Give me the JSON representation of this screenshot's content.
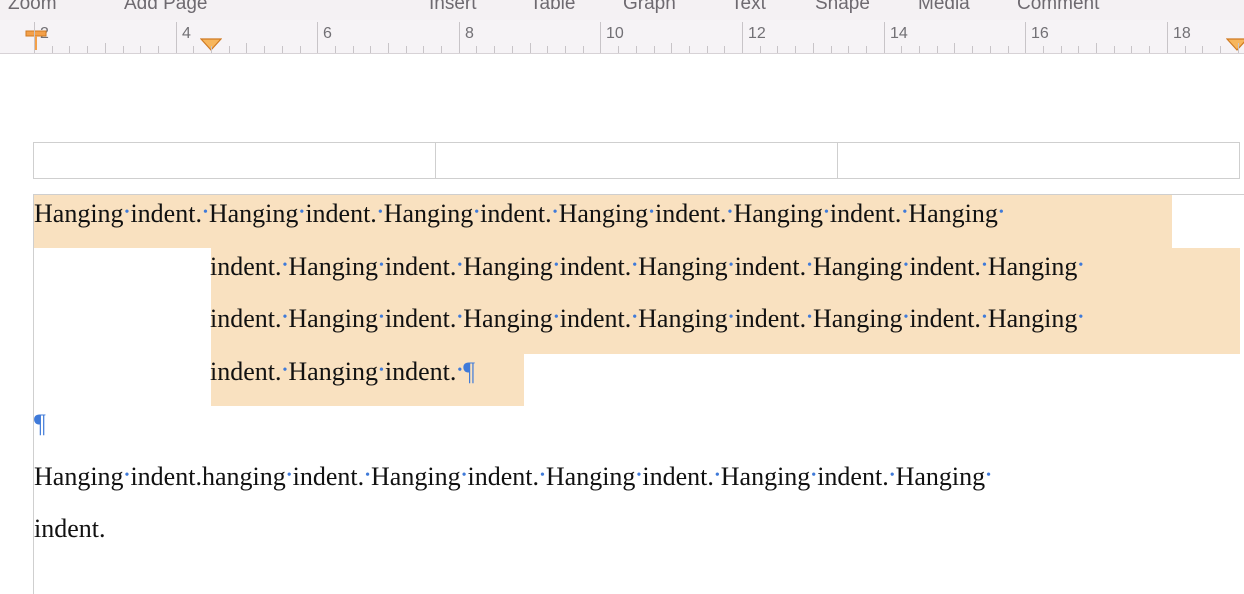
{
  "toolbar": {
    "items": [
      "Zoom",
      "Add Page",
      "Insert",
      "Table",
      "Graph",
      "Text",
      "Shape",
      "Media",
      "Comment"
    ]
  },
  "ruler": {
    "labels": [
      "2",
      "4",
      "6",
      "8",
      "10",
      "12",
      "14",
      "16",
      "18"
    ]
  },
  "paragraph1": {
    "lines": [
      [
        "Hanging",
        "indent.",
        "Hanging",
        "indent.",
        "Hanging",
        "indent.",
        "Hanging",
        "indent.",
        "Hanging",
        "indent.",
        "Hanging"
      ],
      [
        "indent.",
        "Hanging",
        "indent.",
        "Hanging",
        "indent.",
        "Hanging",
        "indent.",
        "Hanging",
        "indent.",
        "Hanging"
      ],
      [
        "indent.",
        "Hanging",
        "indent.",
        "Hanging",
        "indent.",
        "Hanging",
        "indent.",
        "Hanging",
        "indent.",
        "Hanging"
      ],
      [
        "indent.",
        "Hanging",
        "indent."
      ]
    ],
    "end_mark": "¶"
  },
  "empty_paragraph_mark": "¶",
  "paragraph2": {
    "lines": [
      [
        "Hanging",
        "indent.hanging",
        "indent.",
        "Hanging",
        "indent.",
        "Hanging",
        "indent.",
        "Hanging",
        "indent.",
        "Hanging"
      ],
      [
        "indent."
      ]
    ]
  },
  "colors": {
    "selection": "#f9e1c0",
    "invisibles": "#3f7ad9",
    "tab_marker": "#f09a3e"
  }
}
